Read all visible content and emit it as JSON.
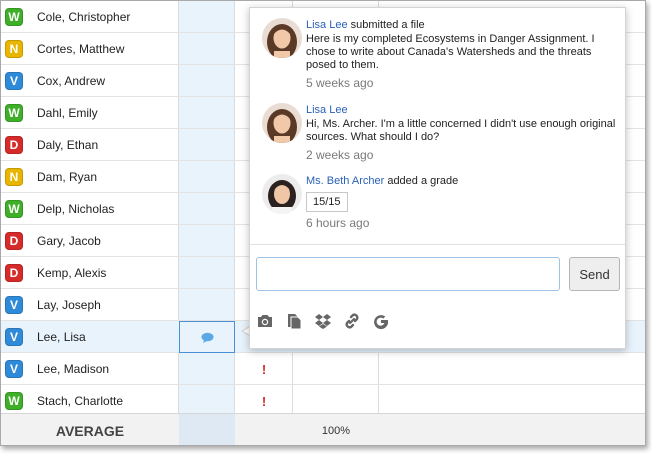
{
  "colors": {
    "accent": "#2a62b8",
    "selected_bg": "#e8f3fc",
    "alert": "#d62b2b"
  },
  "students": [
    {
      "badge": "W",
      "name": "Cole, Christopher"
    },
    {
      "badge": "N",
      "name": "Cortes, Matthew"
    },
    {
      "badge": "V",
      "name": "Cox, Andrew"
    },
    {
      "badge": "W",
      "name": "Dahl, Emily"
    },
    {
      "badge": "D",
      "name": "Daly, Ethan"
    },
    {
      "badge": "N",
      "name": "Dam, Ryan"
    },
    {
      "badge": "W",
      "name": "Delp, Nicholas"
    },
    {
      "badge": "D",
      "name": "Gary, Jacob"
    },
    {
      "badge": "D",
      "name": "Kemp, Alexis"
    },
    {
      "badge": "V",
      "name": "Lay, Joseph"
    },
    {
      "badge": "V",
      "name": "Lee, Lisa"
    },
    {
      "badge": "V",
      "name": "Lee, Madison"
    },
    {
      "badge": "W",
      "name": "Stach, Charlotte"
    }
  ],
  "alerts": {
    "mark": "!"
  },
  "average": {
    "label": "AVERAGE",
    "value": "100%"
  },
  "popup": {
    "messages": [
      {
        "author": "Lisa Lee",
        "action": " submitted a file",
        "text": "Here is my completed Ecosystems in Danger Assignment. I chose to write about Canada's Watersheds and the threats posed to them.",
        "time": "5 weeks ago"
      },
      {
        "author": "Lisa Lee",
        "action": "",
        "text": "Hi, Ms. Archer. I'm a little concerned I didn't use enough original sources. What should I do?",
        "time": "2 weeks ago"
      },
      {
        "author": "Ms. Beth Archer",
        "action": " added a grade",
        "grade": "15/15",
        "time": "6 hours ago"
      }
    ],
    "input_placeholder": "",
    "send_label": "Send",
    "toolbar_icons": [
      "camera-icon",
      "copy-files-icon",
      "dropbox-icon",
      "link-icon",
      "google-icon"
    ]
  }
}
